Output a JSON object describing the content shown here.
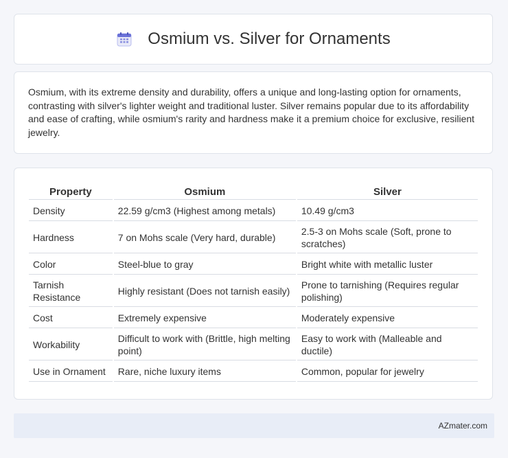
{
  "header": {
    "title": "Osmium vs. Silver for Ornaments",
    "icon": "calendar-icon",
    "icon_color": "#6b72d8"
  },
  "intro": {
    "text": "Osmium, with its extreme density and durability, offers a unique and long-lasting option for ornaments, contrasting with silver's lighter weight and traditional luster. Silver remains popular due to its affordability and ease of crafting, while osmium's rarity and hardness make it a premium choice for exclusive, resilient jewelry."
  },
  "table": {
    "headers": [
      "Property",
      "Osmium",
      "Silver"
    ],
    "rows": [
      [
        "Density",
        "22.59 g/cm3 (Highest among metals)",
        "10.49 g/cm3"
      ],
      [
        "Hardness",
        "7 on Mohs scale (Very hard, durable)",
        "2.5-3 on Mohs scale (Soft, prone to scratches)"
      ],
      [
        "Color",
        "Steel-blue to gray",
        "Bright white with metallic luster"
      ],
      [
        "Tarnish Resistance",
        "Highly resistant (Does not tarnish easily)",
        "Prone to tarnishing (Requires regular polishing)"
      ],
      [
        "Cost",
        "Extremely expensive",
        "Moderately expensive"
      ],
      [
        "Workability",
        "Difficult to work with (Brittle, high melting point)",
        "Easy to work with (Malleable and ductile)"
      ],
      [
        "Use in Ornament",
        "Rare, niche luxury items",
        "Common, popular for jewelry"
      ]
    ]
  },
  "footer": {
    "brand": "AZmater.com"
  }
}
